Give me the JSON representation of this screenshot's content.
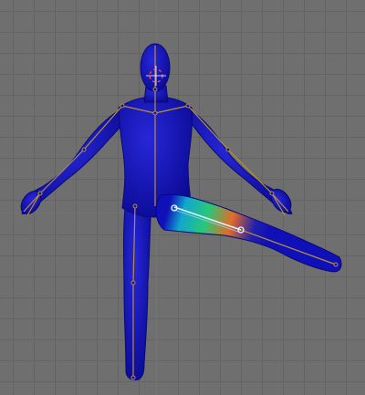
{
  "viewport": {
    "background_color": "#6f6f6f",
    "grid_color": "#626262",
    "axis_x_color": "#a86363",
    "axis_y_color": "#6c6cc6",
    "mesh_color": "#1010b8",
    "mesh_shade_color": "#0a0a8e",
    "armature_color": "#c8a040",
    "selected_bone_color": "#e8f4ff",
    "weight_gradient_colors": [
      "#1010b8",
      "#11c0d0",
      "#2ed05a",
      "#e8782a",
      "#1010b8"
    ],
    "cursor_3d_colors": [
      "#ff4040",
      "#ffffff"
    ]
  }
}
